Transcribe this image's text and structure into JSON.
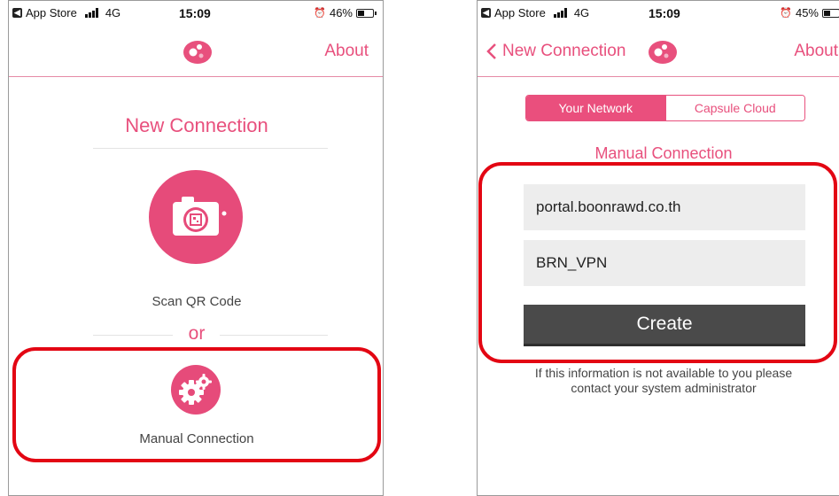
{
  "colors": {
    "accent": "#e8507d",
    "highlight": "#e30613",
    "button": "#4a4a4a"
  },
  "left": {
    "status": {
      "carrier": "App Store",
      "network": "4G",
      "time": "15:09",
      "battery": "46%",
      "battery_level": 0.46
    },
    "nav": {
      "right_label": "About",
      "logo_icon": "capsule-logo-icon"
    },
    "title": "New Connection",
    "scan": {
      "icon": "camera-qr-icon",
      "label": "Scan QR Code"
    },
    "divider_label": "or",
    "manual": {
      "icon": "gears-icon",
      "label": "Manual Connection"
    }
  },
  "right": {
    "status": {
      "carrier": "App Store",
      "network": "4G",
      "time": "15:09",
      "battery": "45%",
      "battery_level": 0.45
    },
    "nav": {
      "back_label": "New Connection",
      "right_label": "About",
      "back_icon": "chevron-left-icon",
      "logo_icon": "capsule-logo-icon"
    },
    "segments": [
      "Your Network",
      "Capsule Cloud"
    ],
    "selected_segment": "Your Network",
    "subtitle": "Manual Connection",
    "server_field": "portal.boonrawd.co.th",
    "name_field": "BRN_VPN",
    "create_label": "Create",
    "note_line1": "If this information is not available to you please",
    "note_line2": "contact your system administrator"
  }
}
